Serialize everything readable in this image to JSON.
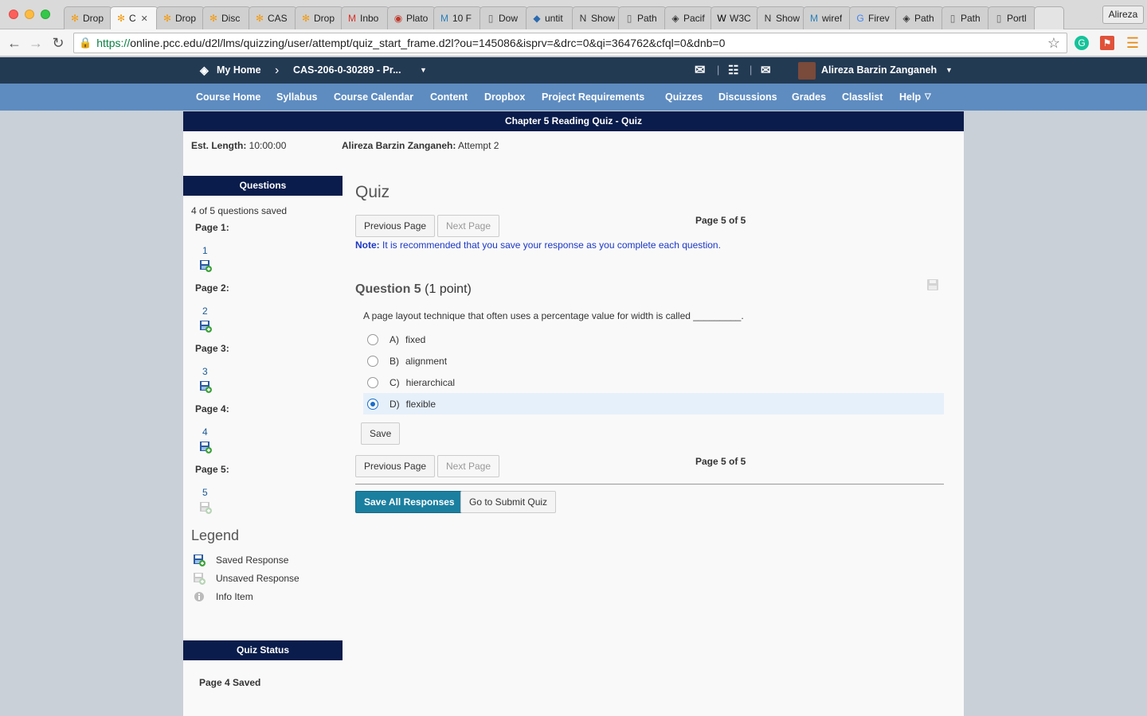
{
  "browser": {
    "tabs": [
      {
        "label": "Drop",
        "icon": "dropbox-icon",
        "active": false
      },
      {
        "label": "C",
        "icon": "dropbox-icon",
        "active": true
      },
      {
        "label": "Drop",
        "icon": "dropbox-icon",
        "active": false
      },
      {
        "label": "Disc",
        "icon": "dropbox-icon",
        "active": false
      },
      {
        "label": "CAS",
        "icon": "dropbox-icon",
        "active": false
      },
      {
        "label": "Drop",
        "icon": "dropbox-icon",
        "active": false
      },
      {
        "label": "Inbo",
        "icon": "gmail-icon",
        "active": false
      },
      {
        "label": "Plato",
        "icon": "plato-icon",
        "active": false
      },
      {
        "label": "10 F",
        "icon": "m-icon",
        "active": false
      },
      {
        "label": "Dow",
        "icon": "page-icon",
        "active": false
      },
      {
        "label": "untit",
        "icon": "code-icon",
        "active": false
      },
      {
        "label": "Show",
        "icon": "n-icon",
        "active": false
      },
      {
        "label": "Path",
        "icon": "page-icon",
        "active": false
      },
      {
        "label": "Pacif",
        "icon": "diamond-icon",
        "active": false
      },
      {
        "label": "W3C",
        "icon": "w3c-icon",
        "active": false
      },
      {
        "label": "Show",
        "icon": "n-icon",
        "active": false
      },
      {
        "label": "wiref",
        "icon": "m-icon",
        "active": false
      },
      {
        "label": "Firev",
        "icon": "google-icon",
        "active": false
      },
      {
        "label": "Path",
        "icon": "diamond-icon",
        "active": false
      },
      {
        "label": "Path",
        "icon": "page-icon",
        "active": false
      },
      {
        "label": "Portl",
        "icon": "page-icon",
        "active": false
      }
    ],
    "profile_name": "Alireza",
    "url_secure": "https://",
    "url_host": "online.pcc.edu",
    "url_path": "/d2l/lms/quizzing/user/attempt/quiz_start_frame.d2l?ou=145086&isprv=&drc=0&qi=364762&cfql=0&dnb=0"
  },
  "minibar": {
    "home": "My Home",
    "course": "CAS-206-0-30289 - Pr...",
    "user": "Alireza Barzin Zanganeh"
  },
  "navbar": {
    "links": [
      "Course Home",
      "Syllabus",
      "Course Calendar",
      "Content",
      "Dropbox",
      "Project Requirements",
      "Quizzes",
      "Discussions",
      "Grades",
      "Classlist",
      "Help"
    ]
  },
  "quiz": {
    "title_bar": "Chapter 5 Reading Quiz - Quiz",
    "est_length_label": "Est. Length:",
    "est_length_value": "10:00:00",
    "attempt_user": "Alireza Barzin Zanganeh:",
    "attempt_value": "Attempt 2"
  },
  "sidebar": {
    "questions_header": "Questions",
    "saved_summary": "4 of 5 questions saved",
    "pages": [
      {
        "label": "Page 1:",
        "question": "1",
        "saved": true
      },
      {
        "label": "Page 2:",
        "question": "2",
        "saved": true
      },
      {
        "label": "Page 3:",
        "question": "3",
        "saved": true
      },
      {
        "label": "Page 4:",
        "question": "4",
        "saved": true
      },
      {
        "label": "Page 5:",
        "question": "5",
        "saved": false
      }
    ],
    "legend_title": "Legend",
    "legend": [
      "Saved Response",
      "Unsaved Response",
      "Info Item"
    ],
    "status_header": "Quiz Status",
    "status_text": "Page 4 Saved"
  },
  "main": {
    "title": "Quiz",
    "prev_label": "Previous Page",
    "next_label": "Next Page",
    "page_indicator": "Page 5 of 5",
    "note_label": "Note:",
    "note_text": "It is recommended that you save your response as you complete each question.",
    "question_label": "Question 5",
    "question_points": "(1 point)",
    "question_text": "A page layout technique that often uses a percentage value for width is called _________.",
    "choices": [
      {
        "letter": "A)",
        "text": "fixed",
        "selected": false
      },
      {
        "letter": "B)",
        "text": "alignment",
        "selected": false
      },
      {
        "letter": "C)",
        "text": "hierarchical",
        "selected": false
      },
      {
        "letter": "D)",
        "text": "flexible",
        "selected": true
      }
    ],
    "save_label": "Save",
    "save_all_label": "Save All Responses",
    "submit_label": "Go to Submit Quiz"
  },
  "colors": {
    "minibar": "#233a53",
    "navbar": "#5e8cc0",
    "header_bar": "#0a1c4b",
    "primary_button": "#1b7fa0",
    "note_text": "#1b37c7",
    "selected_row": "#e6f0fb"
  }
}
